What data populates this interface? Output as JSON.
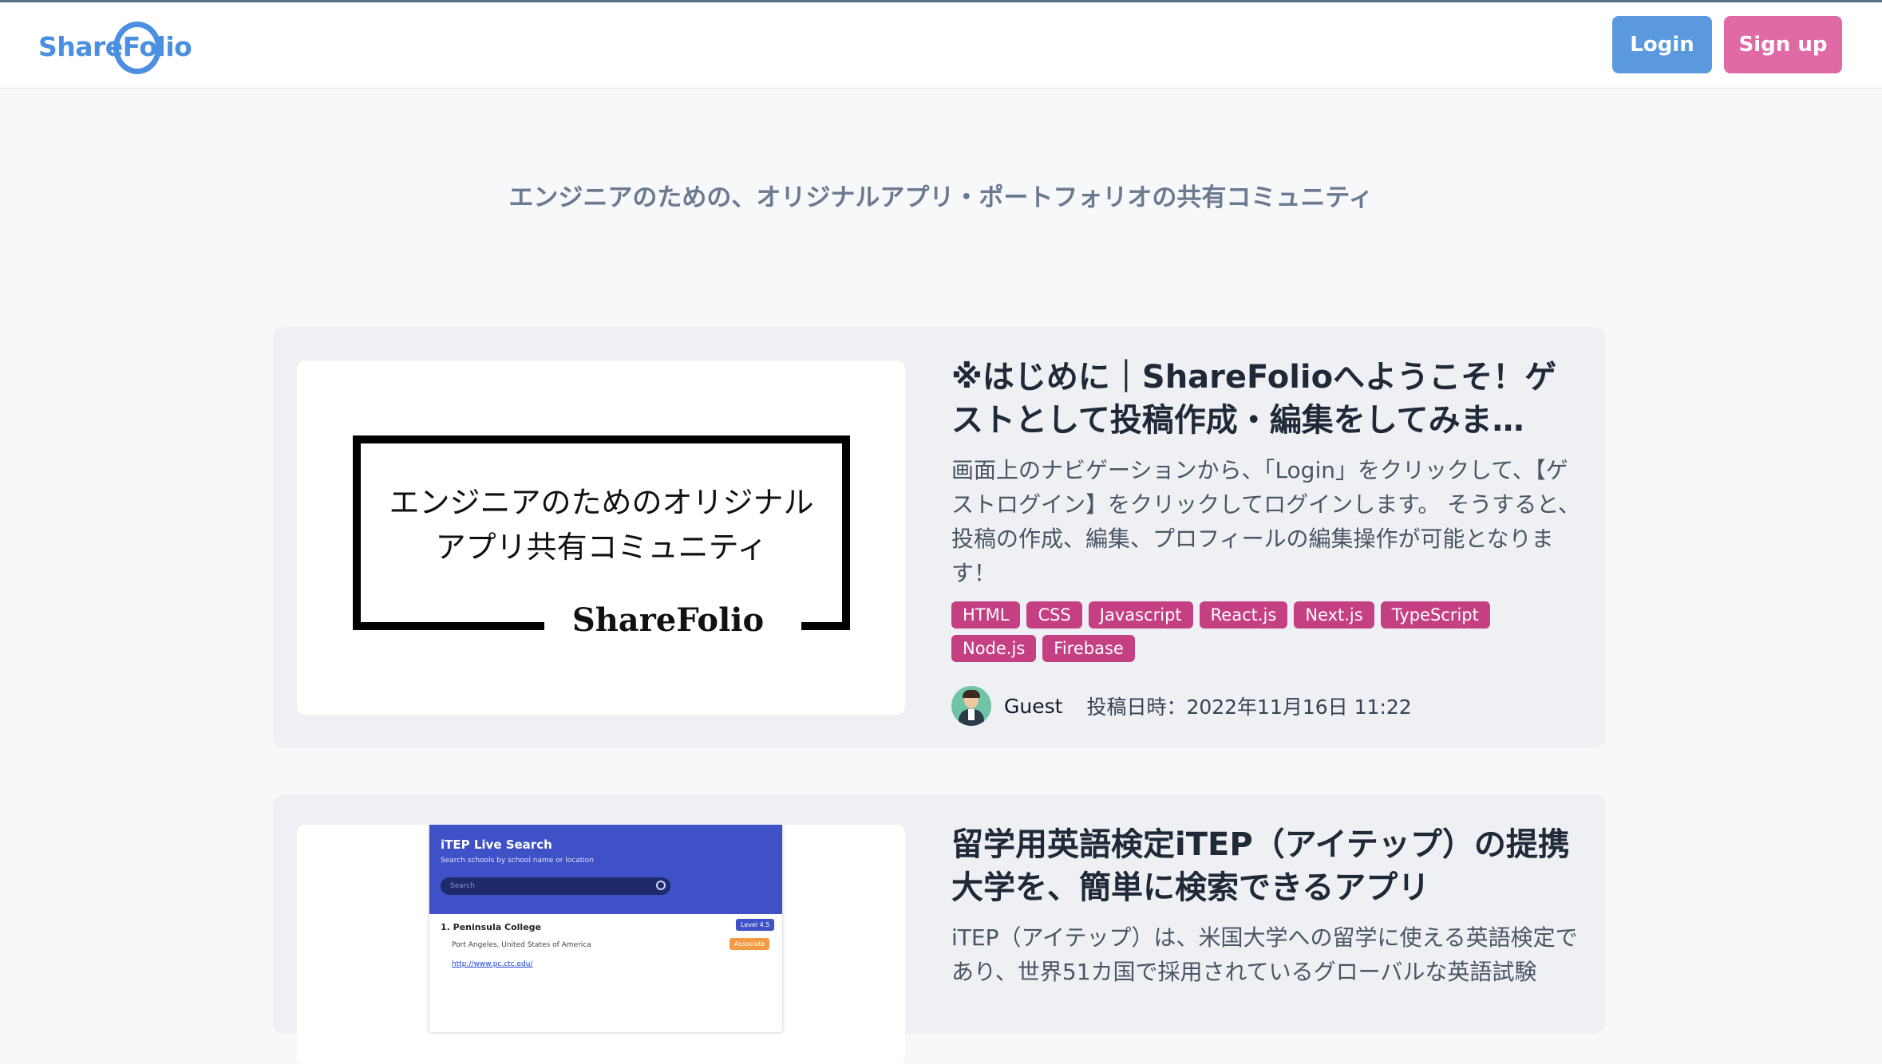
{
  "header": {
    "logo_text": "ShareFolio",
    "login_label": "Login",
    "signup_label": "Sign up"
  },
  "tagline": "エンジニアのための、オリジナルアプリ・ポートフォリオの共有コミュニティ",
  "posts": [
    {
      "thumbnail": {
        "line1": "エンジニアのためのオリジナル",
        "line2": "アプリ共有コミュニティ",
        "brand": "ShareFolio"
      },
      "title": "※はじめに｜ShareFolioへようこそ！ゲストとして投稿作成・編集をしてみま…",
      "description": "画面上のナビゲーションから、「Login」をクリックして、【ゲストログイン】をクリックしてログインします。 そうすると、投稿の作成、編集、プロフィールの編集操作が可能となります！",
      "tags": [
        "HTML",
        "CSS",
        "Javascript",
        "React.js",
        "Next.js",
        "TypeScript",
        "Node.js",
        "Firebase"
      ],
      "author": "Guest",
      "posted_at": "投稿日時：2022年11月16日 11:22"
    },
    {
      "thumbnail": {
        "app_title": "iTEP Live Search",
        "app_subtitle": "Search schools by school name or location",
        "search_placeholder": "Search",
        "result_name": "1. Peninsula College",
        "result_location": "Port Angeles, United States of America",
        "result_link": "http://www.pc.ctc.edu/",
        "badge_level": "Level 4.5",
        "badge_type": "Associate"
      },
      "title": "留学用英語検定iTEP（アイテップ）の提携大学を、簡単に検索できるアプリ",
      "description": "iTEP（アイテップ）は、米国大学への留学に使える英語検定であり、世界51カ国で採用されているグローバルな英語試験"
    }
  ]
}
